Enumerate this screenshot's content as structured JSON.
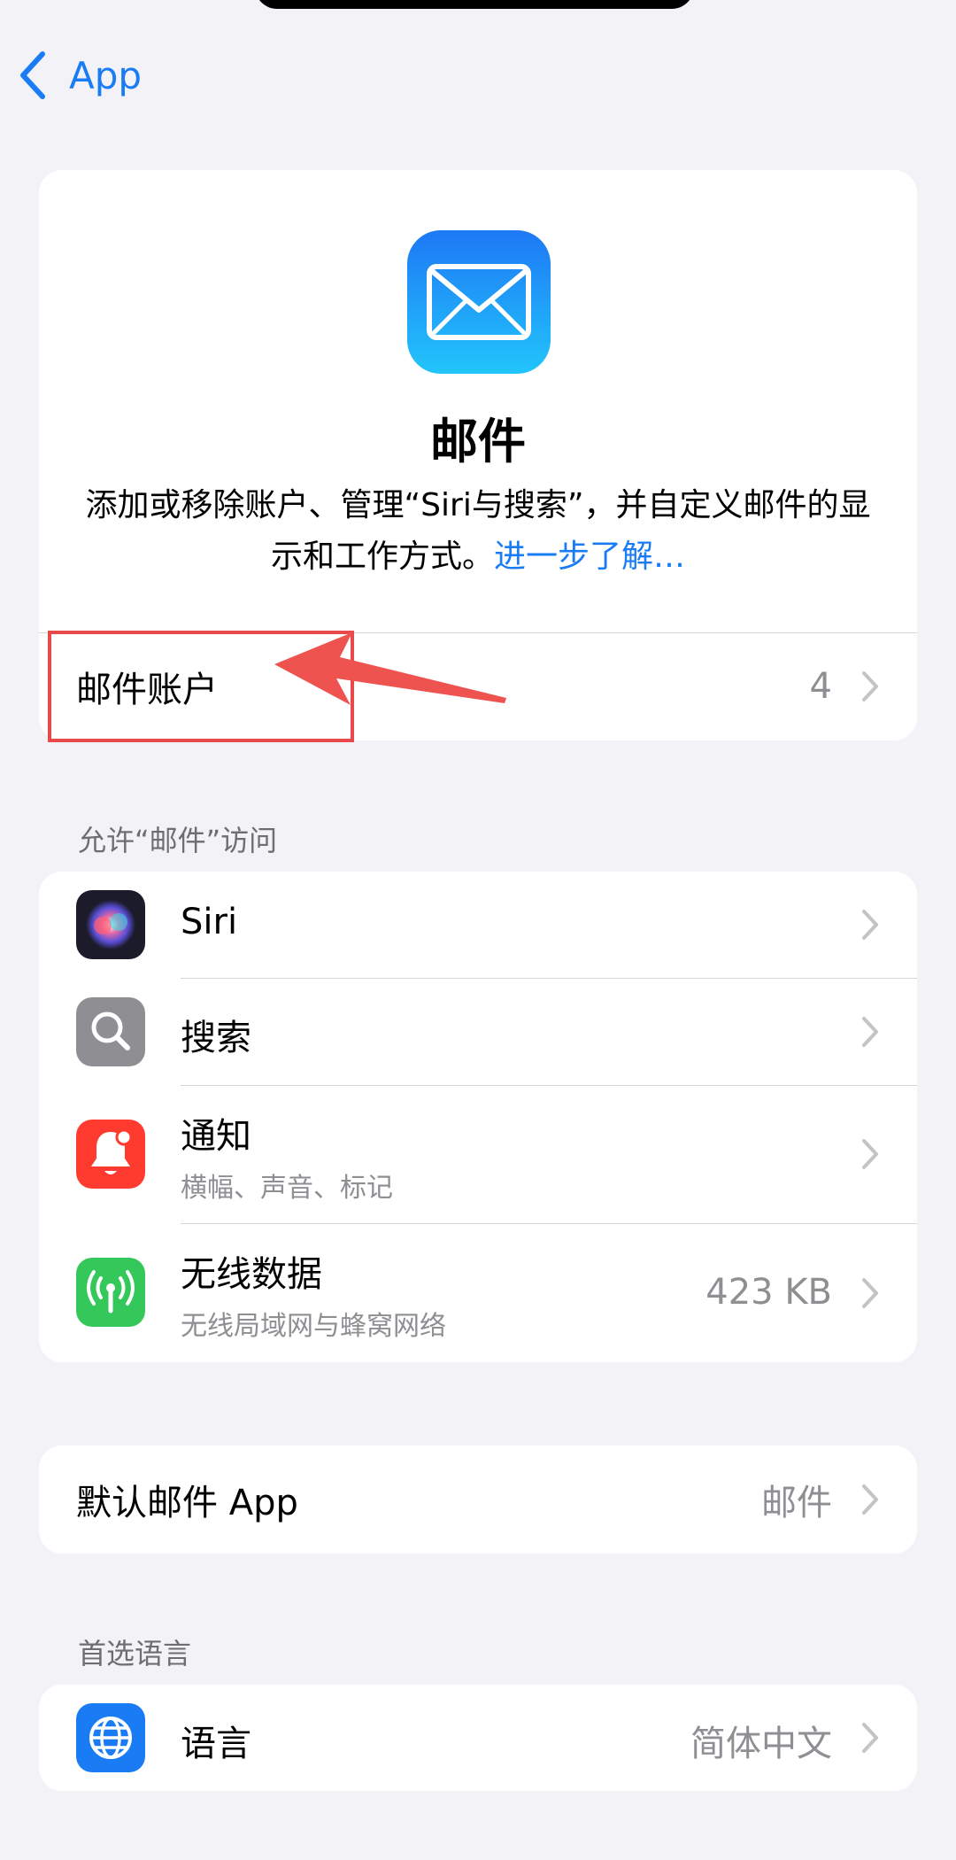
{
  "nav": {
    "back_label": "App"
  },
  "hero": {
    "icon": "mail-envelope-icon",
    "title": "邮件",
    "description": "添加或移除账户、管理“Siri与搜索”，并自定义邮件的显示和工作方式。",
    "learn_more": "进一步了解…"
  },
  "accounts": {
    "label": "邮件账户",
    "count": "4"
  },
  "access_section": {
    "header": "允许“邮件”访问",
    "items": [
      {
        "icon": "siri-icon",
        "title": "Siri"
      },
      {
        "icon": "search-icon",
        "title": "搜索"
      },
      {
        "icon": "notification-bell-icon",
        "title": "通知",
        "subtitle": "横幅、声音、标记"
      },
      {
        "icon": "wireless-data-icon",
        "title": "无线数据",
        "subtitle": "无线局域网与蜂窝网络",
        "value": "423 KB"
      }
    ]
  },
  "default_app": {
    "label": "默认邮件 App",
    "value": "邮件"
  },
  "language_section": {
    "header": "首选语言",
    "item": {
      "icon": "globe-icon",
      "title": "语言",
      "value": "简体中文"
    }
  },
  "colors": {
    "accent": "#1a7cf5",
    "annotation": "#e8494a",
    "background": "#f2f2f7"
  }
}
